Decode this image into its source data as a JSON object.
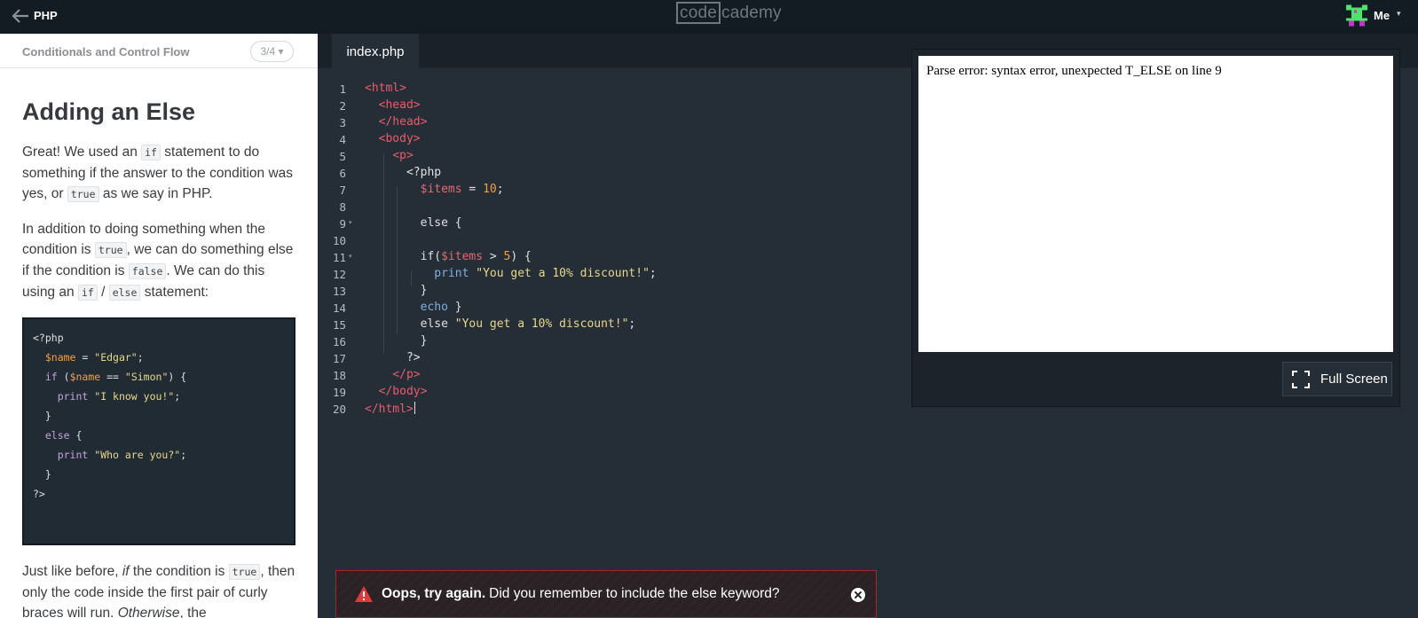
{
  "topbar": {
    "back_icon": "arrow-left-icon",
    "course": "PHP",
    "logo_left": "code",
    "logo_right": "cademy",
    "user": "Me",
    "user_caret": "▾"
  },
  "lesson": {
    "unit_title": "Conditionals and Control Flow",
    "progress": "3/4 ▾",
    "heading": "Adding an Else",
    "p1": {
      "a": "Great! We used an ",
      "code1": "if",
      "b": " statement to do something if the answer to the condition was yes, or ",
      "code2": "true",
      "c": " as we say in PHP."
    },
    "p2": {
      "a": "In addition to doing something when the condition is ",
      "code1": "true",
      "b": ", we can do something else if the condition is ",
      "code2": "false",
      "c": ". We can do this using an ",
      "code3": "if",
      "d": " / ",
      "code4": "else",
      "e": " statement:"
    },
    "snippet": [
      "<?php",
      "  $name = \"Edgar\";",
      "",
      "  if ($name == \"Simon\") {",
      "    print \"I know you!\";",
      "  }",
      "  else {",
      "    print \"Who are you?\";",
      "  }",
      "?>"
    ],
    "p3": {
      "a": "Just like before, ",
      "em1": "if",
      "b": " the condition is ",
      "code1": "true",
      "c": ", then only the code inside the first pair of curly braces will run. ",
      "em2": "Otherwise",
      "d": ", the"
    }
  },
  "editor": {
    "tab": "index.php",
    "line_numbers": [
      "1",
      "2",
      "3",
      "4",
      "5",
      "6",
      "7",
      "8",
      "9",
      "10",
      "11",
      "12",
      "13",
      "14",
      "15",
      "16",
      "17",
      "18",
      "19",
      "20"
    ],
    "fold_marker": "▾"
  },
  "output": {
    "text": "Parse error: syntax error, unexpected T_ELSE on line 9",
    "fullscreen_label": "Full Screen",
    "fullscreen_icon": "expand-icon"
  },
  "banner": {
    "icon": "warning-icon",
    "bold": "Oops, try again.",
    "message": "Did you remember to include the else keyword?",
    "close_icon": "close-icon"
  },
  "colors": {
    "topbar": "#141c23",
    "editor_bg": "#252d36",
    "tag": "#eb5c6b",
    "string": "#e6d98b",
    "number": "#f0a04b",
    "keyword": "#7fb0de",
    "error_border": "#9e2a2a",
    "warning": "#e03b3b"
  }
}
